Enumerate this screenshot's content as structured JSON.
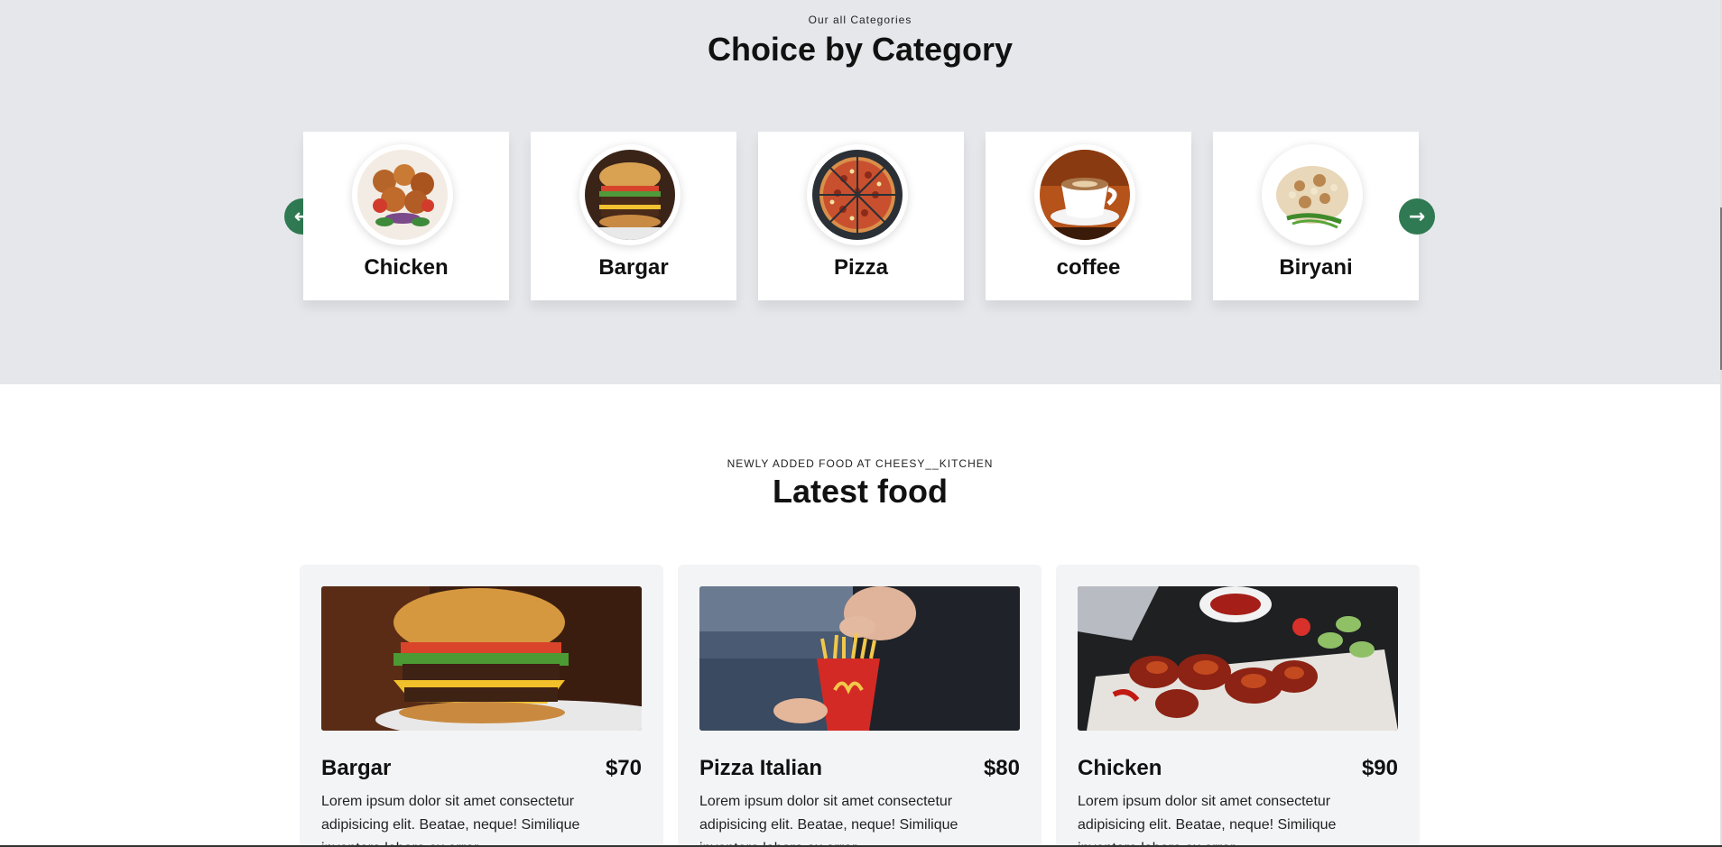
{
  "categories_section": {
    "eyebrow": "Our all Categories",
    "title": "Choice by Category",
    "prev_icon": "arrow-left-icon",
    "next_icon": "arrow-right-icon",
    "prev_symbol": "←",
    "next_symbol": "→",
    "accent_color": "#2f7a52",
    "items": [
      {
        "label": "Chicken"
      },
      {
        "label": "Bargar"
      },
      {
        "label": "Pizza"
      },
      {
        "label": "coffee"
      },
      {
        "label": "Biryani"
      }
    ]
  },
  "latest_section": {
    "eyebrow": "NEWLY ADDED FOOD AT CHEESY__KITCHEN",
    "title": "Latest food",
    "items": [
      {
        "name": "Bargar",
        "price": "$70",
        "description": "Lorem ipsum dolor sit amet consectetur adipisicing elit. Beatae, neque! Similique inventore labore ex error"
      },
      {
        "name": "Pizza Italian",
        "price": "$80",
        "description": "Lorem ipsum dolor sit amet consectetur adipisicing elit. Beatae, neque! Similique inventore labore ex error"
      },
      {
        "name": "Chicken",
        "price": "$90",
        "description": "Lorem ipsum dolor sit amet consectetur adipisicing elit. Beatae, neque! Similique inventore labore ex error"
      }
    ]
  }
}
